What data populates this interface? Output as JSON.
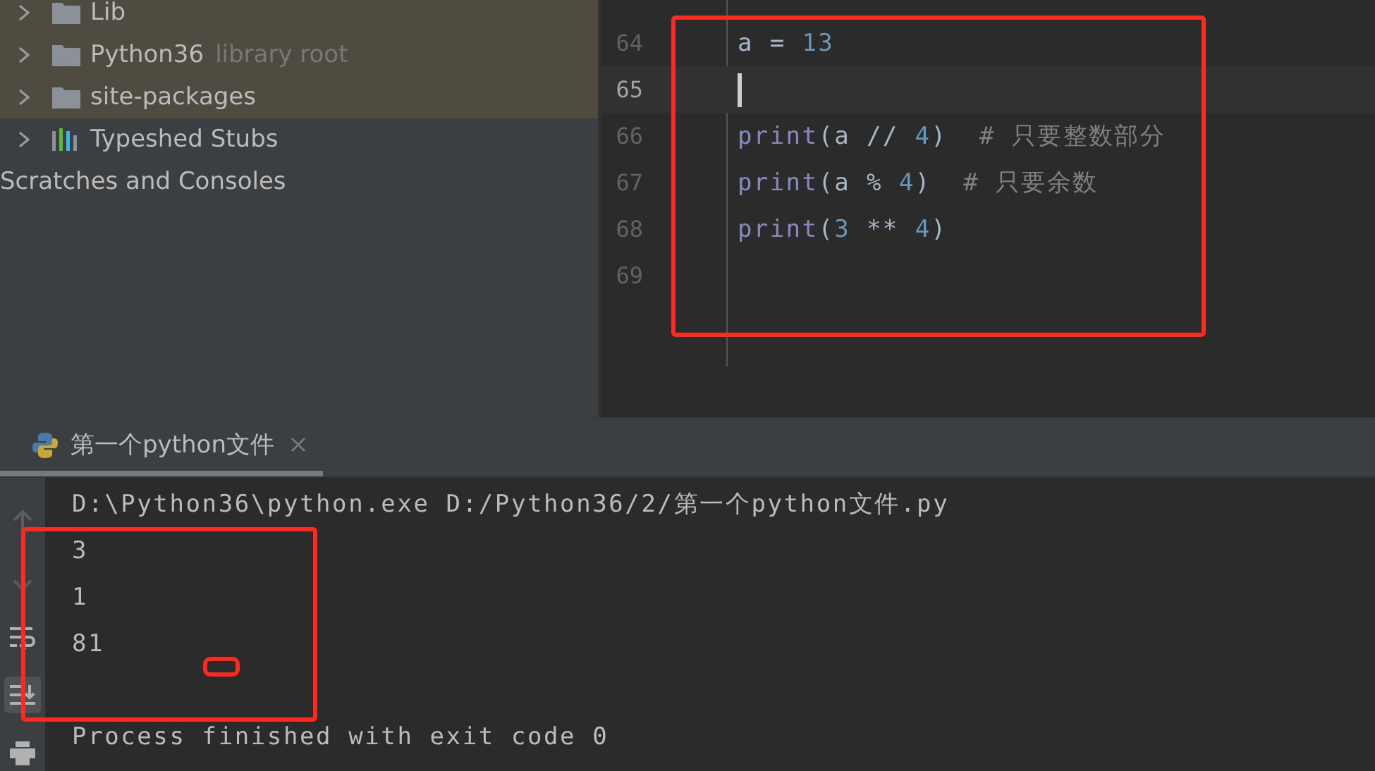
{
  "project_tree": {
    "items": [
      {
        "label": "Lib",
        "kind": "folder",
        "expandable": true,
        "highlighted": true
      },
      {
        "label": "Python36",
        "hint": "library root",
        "kind": "folder",
        "expandable": true,
        "highlighted": true
      },
      {
        "label": "site-packages",
        "kind": "folder",
        "expandable": true,
        "highlighted": true
      },
      {
        "label": "Typeshed Stubs",
        "kind": "stubs",
        "expandable": true,
        "highlighted": false
      },
      {
        "label": "Scratches and Consoles",
        "kind": "scratches",
        "expandable": false,
        "highlighted": false
      }
    ]
  },
  "editor": {
    "lines": [
      {
        "number": "64",
        "current": false,
        "tokens": [
          {
            "text": "a = ",
            "kind": "plain"
          },
          {
            "text": "13",
            "kind": "number"
          }
        ]
      },
      {
        "number": "65",
        "current": true
      },
      {
        "number": "66",
        "current": false,
        "tokens": [
          {
            "text": "print",
            "kind": "builtin"
          },
          {
            "text": "(a // ",
            "kind": "plain"
          },
          {
            "text": "4",
            "kind": "number"
          },
          {
            "text": ")  ",
            "kind": "plain"
          },
          {
            "text": "# 只要整数部分",
            "kind": "comment"
          }
        ]
      },
      {
        "number": "67",
        "current": false,
        "tokens": [
          {
            "text": "print",
            "kind": "builtin"
          },
          {
            "text": "(a % ",
            "kind": "plain"
          },
          {
            "text": "4",
            "kind": "number"
          },
          {
            "text": ")  ",
            "kind": "plain"
          },
          {
            "text": "# 只要余数",
            "kind": "comment"
          }
        ]
      },
      {
        "number": "68",
        "current": false,
        "tokens": [
          {
            "text": "print",
            "kind": "builtin"
          },
          {
            "text": "(",
            "kind": "plain"
          },
          {
            "text": "3",
            "kind": "number"
          },
          {
            "text": " ** ",
            "kind": "plain"
          },
          {
            "text": "4",
            "kind": "number"
          },
          {
            "text": ")",
            "kind": "plain"
          }
        ]
      },
      {
        "number": "69",
        "current": false
      }
    ]
  },
  "run_panel": {
    "tabs": [
      {
        "label": "第一个python文件",
        "selected": true
      }
    ],
    "toolbar": [
      {
        "kind": "up",
        "disabled": true
      },
      {
        "kind": "down",
        "disabled": true
      },
      {
        "kind": "wrap",
        "disabled": false
      },
      {
        "kind": "scroll-end",
        "active": true
      },
      {
        "kind": "print",
        "disabled": false
      }
    ],
    "output": [
      {
        "text": "D:\\Python36\\python.exe D:/Python36/2/第一个python文件.py",
        "kind": "line"
      },
      {
        "text": "3",
        "kind": "line"
      },
      {
        "text": "1",
        "kind": "line"
      },
      {
        "text": "81",
        "kind": "line"
      },
      {
        "text": "Process finished with exit code 0",
        "kind": "summary"
      }
    ]
  }
}
